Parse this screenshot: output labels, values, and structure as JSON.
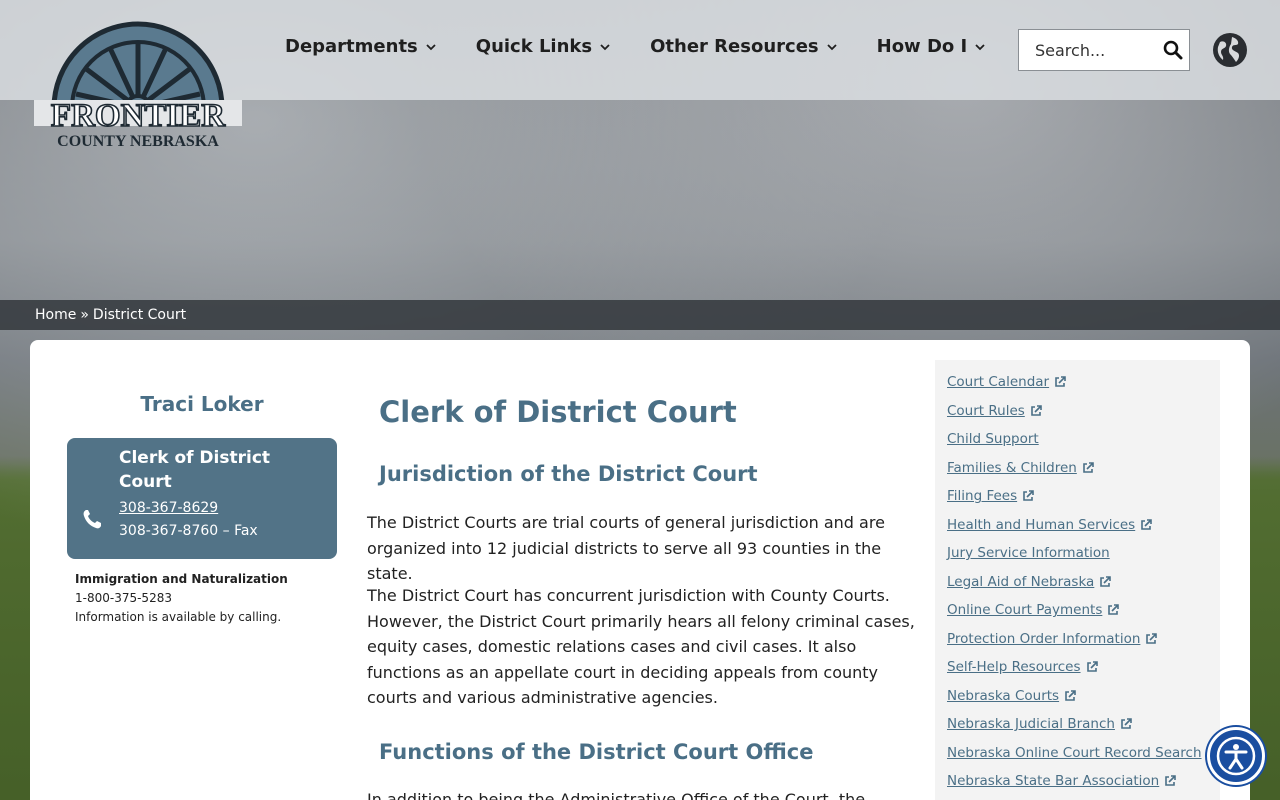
{
  "header": {
    "logo": {
      "line1": "FRONTIER",
      "line2": "COUNTY NEBRASKA"
    },
    "nav": [
      {
        "label": "Departments"
      },
      {
        "label": "Quick Links"
      },
      {
        "label": "Other Resources"
      },
      {
        "label": "How Do I"
      }
    ],
    "search": {
      "placeholder": "Search..."
    }
  },
  "breadcrumb": {
    "home": "Home",
    "separator": "»",
    "current": "District Court"
  },
  "contact": {
    "name": "Traci Loker",
    "title": "Clerk of District Court",
    "phone": "308-367-8629",
    "fax": "308-367-8760 – Fax",
    "extra_title": "Immigration and Naturalization",
    "extra_phone": "1-800-375-5283",
    "extra_note": "Information is available by calling."
  },
  "main": {
    "title": "Clerk of District Court",
    "section1_heading": "Jurisdiction of the District Court",
    "para1": "The District Courts are trial courts of general jurisdiction and are organized into 12 judicial districts to serve all 93 counties in the state.",
    "para2": "The District Court has concurrent jurisdiction with County Courts. However, the District Court primarily hears all felony criminal cases, equity cases, domestic relations cases and civil cases. It also functions as an appellate court in deciding appeals from county courts and various administrative agencies.",
    "section2_heading": "Functions of the District Court Office",
    "para3": "In addition to being the Administrative Office of the Court, the Clerks"
  },
  "sidebar": {
    "links": [
      {
        "label": "Court Calendar",
        "external": true
      },
      {
        "label": "Court Rules",
        "external": true
      },
      {
        "label": "Child Support",
        "external": false
      },
      {
        "label": "Families & Children",
        "external": true
      },
      {
        "label": "Filing Fees",
        "external": true
      },
      {
        "label": "Health and Human Services",
        "external": true
      },
      {
        "label": "Jury Service Information",
        "external": false
      },
      {
        "label": "Legal Aid of Nebraska",
        "external": true
      },
      {
        "label": "Online Court Payments",
        "external": true
      },
      {
        "label": "Protection Order Information",
        "external": true
      },
      {
        "label": "Self-Help Resources",
        "external": true
      },
      {
        "label": "Nebraska Courts",
        "external": true
      },
      {
        "label": "Nebraska Judicial Branch",
        "external": true
      },
      {
        "label": "Nebraska Online Court Record Search",
        "external": true
      },
      {
        "label": "Nebraska State Bar Association",
        "external": true
      }
    ]
  },
  "colors": {
    "accent": "#4a6f86",
    "contact_box": "#527387",
    "a11y": "#1a4ea0"
  },
  "icons": [
    "wagon-wheel-logo",
    "chevron-down-icon",
    "search-icon",
    "globe-icon",
    "phone-icon",
    "external-link-icon",
    "accessibility-icon"
  ]
}
